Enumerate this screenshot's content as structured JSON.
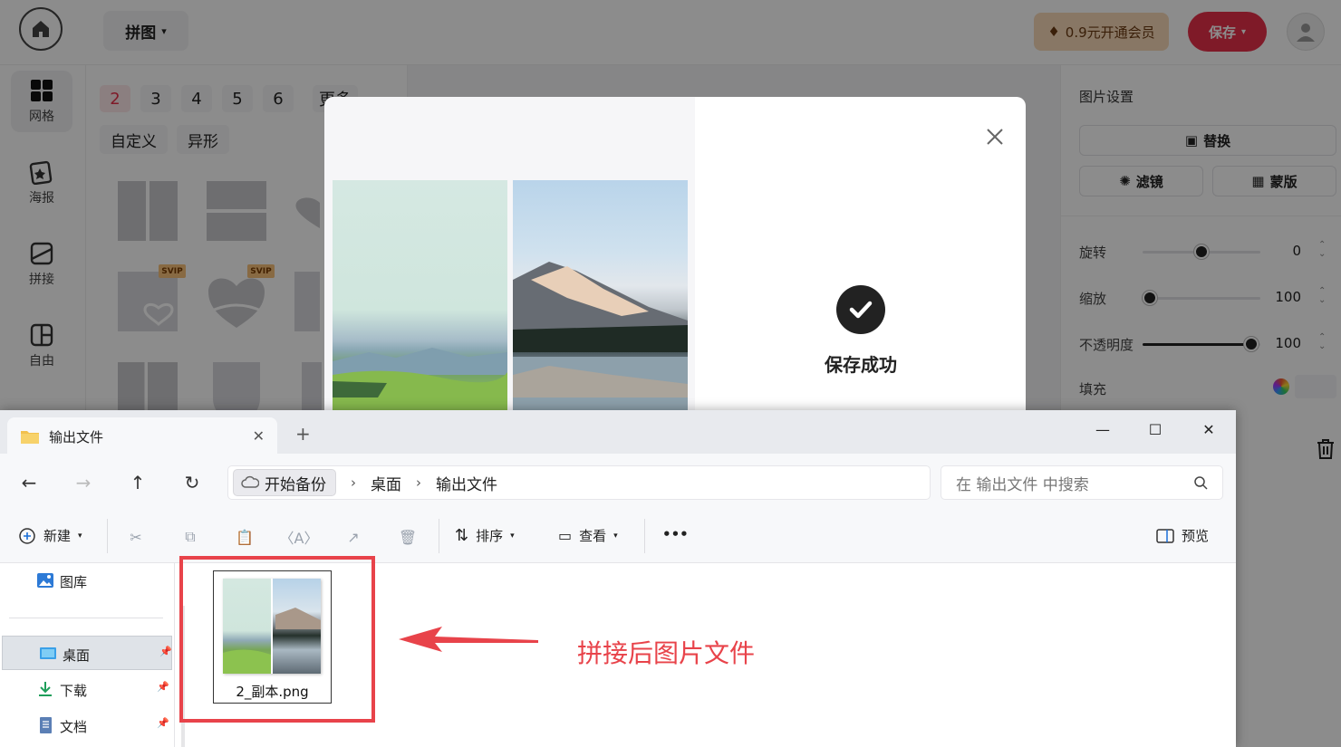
{
  "app": {
    "mode_label": "拼图",
    "vip_label": "0.9元开通会员",
    "save_label": "保存",
    "nav": [
      {
        "label": "网格",
        "icon": "grid-icon"
      },
      {
        "label": "海报",
        "icon": "poster-icon"
      },
      {
        "label": "拼接",
        "icon": "stitch-icon"
      },
      {
        "label": "自由",
        "icon": "free-layout-icon"
      }
    ],
    "count_tabs": [
      "2",
      "3",
      "4",
      "5",
      "6",
      "更多"
    ],
    "active_count": "2",
    "shape_tabs": [
      "自定义",
      "异形"
    ],
    "svip_badge": "SVIP",
    "right_panel": {
      "title": "图片设置",
      "replace_label": "替换",
      "filter_label": "滤镜",
      "mask_label": "蒙版",
      "rotate_label": "旋转",
      "rotate_value": "0",
      "zoom_label": "缩放",
      "zoom_value": "100",
      "opacity_label": "不透明度",
      "opacity_value": "100",
      "fill_label": "填充"
    }
  },
  "modal": {
    "success_text": "保存成功"
  },
  "explorer": {
    "tab_title": "输出文件",
    "breadcrumb": [
      "开始备份",
      "桌面",
      "输出文件"
    ],
    "search_placeholder": "在 输出文件 中搜索",
    "commands": {
      "new": "新建",
      "sort": "排序",
      "view": "查看",
      "more": "•••",
      "preview": "预览"
    },
    "sidebar": [
      {
        "label": "图库",
        "icon": "gallery-icon",
        "pinned": false
      },
      {
        "label": "桌面",
        "icon": "desktop-icon",
        "pinned": true,
        "selected": true
      },
      {
        "label": "下载",
        "icon": "download-icon",
        "pinned": true
      },
      {
        "label": "文档",
        "icon": "documents-icon",
        "pinned": true
      }
    ],
    "file": {
      "name": "2_副本.png"
    }
  },
  "annotation": {
    "text": "拼接后图片文件",
    "color": "#e8434a"
  },
  "colors": {
    "brand_red": "#e8304a",
    "vip_gold": "#f7d9b8"
  }
}
